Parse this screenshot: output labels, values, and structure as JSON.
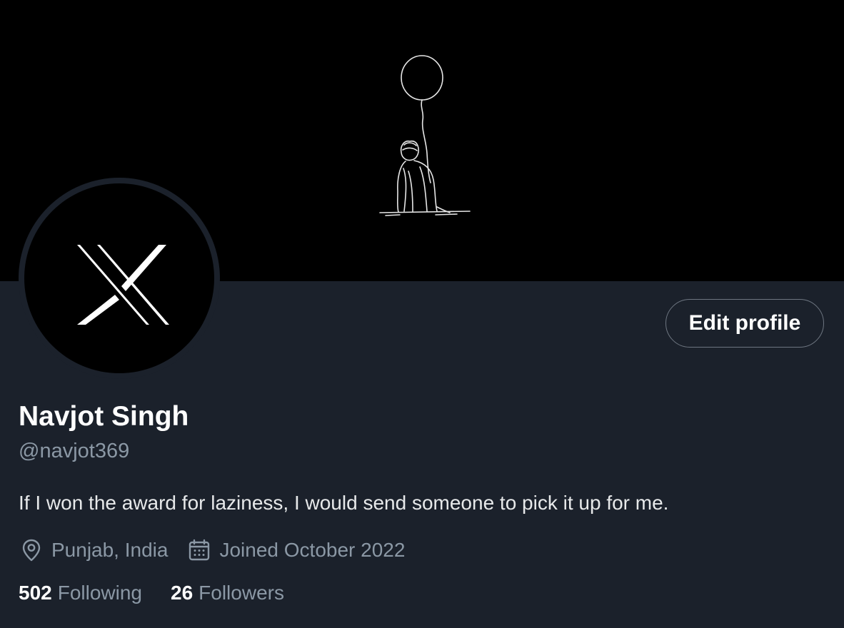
{
  "profile": {
    "display_name": "Navjot Singh",
    "handle": "@navjot369",
    "bio": "If I won the award for laziness, I would send someone to pick it up for me.",
    "location": "Punjab, India",
    "joined": "Joined October 2022",
    "location_icon": "location-pin-icon",
    "joined_icon": "calendar-icon",
    "avatar_icon": "x-logo-icon"
  },
  "actions": {
    "edit_profile_label": "Edit profile"
  },
  "stats": {
    "following_count": "502",
    "following_label": "Following",
    "followers_count": "26",
    "followers_label": "Followers"
  },
  "colors": {
    "background": "#1b212b",
    "banner": "#000000",
    "primary_text": "#ffffff",
    "secondary_text": "#8b98a5",
    "button_border": "#6e7681"
  }
}
